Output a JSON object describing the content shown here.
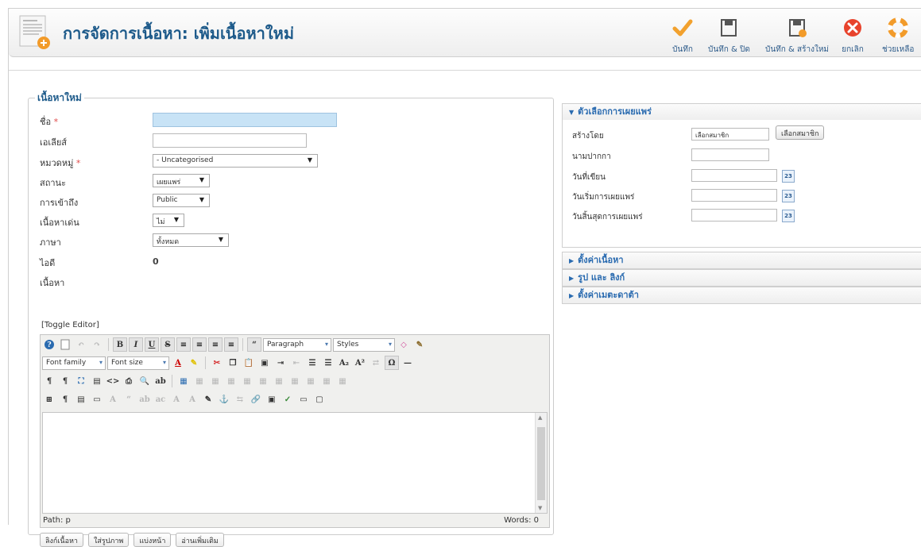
{
  "header": {
    "title": "การจัดการเนื้อหา: เพิ่มเนื้อหาใหม่"
  },
  "toolbar": {
    "save": "บันทึก",
    "save_close": "บันทึก & ปิด",
    "save_new": "บันทึก & สร้างใหม่",
    "cancel": "ยกเลิก",
    "help": "ช่วยเหลือ"
  },
  "form": {
    "legend": "เนื้อหาใหม่",
    "title_label": "ชื่อ",
    "alias_label": "เอเลียส์",
    "category_label": "หมวดหมู่",
    "category_value": "- Uncategorised",
    "status_label": "สถานะ",
    "status_value": "เผยแพร่",
    "access_label": "การเข้าถึง",
    "access_value": "Public",
    "featured_label": "เนื้อหาเด่น",
    "featured_value": "ไม่",
    "language_label": "ภาษา",
    "language_value": "ทั้งหมด",
    "id_label": "ไอดี",
    "id_value": "0",
    "content_label": "เนื้อหา",
    "required_mark": "*"
  },
  "editor": {
    "toggle": "[Toggle Editor]",
    "format_value": "Paragraph",
    "styles_value": "Styles",
    "font_family": "Font family",
    "font_size": "Font size",
    "path": "Path: p",
    "words": "Words: 0"
  },
  "bottom_buttons": [
    "ลิงก์เนื้อหา",
    "ใส่รูปภาพ",
    "แบ่งหน้า",
    "อ่านเพิ่มเติม"
  ],
  "publishing": {
    "header": "ตัวเลือกการเผยแพร่",
    "created_by_label": "สร้างโดย",
    "created_by_value": "เลือกสมาชิก",
    "select_user_button": "เลือกสมาชิก",
    "alias_label": "นามปากกา",
    "created_date_label": "วันที่เขียน",
    "publish_up_label": "วันเริ่มการเผยแพร่",
    "publish_down_label": "วันสิ้นสุดการเผยแพร่",
    "calendar_text": "23"
  },
  "panels": {
    "content_settings": "ตั้งค่าเนื้อหา",
    "images_links": "รูป และ ลิงก์",
    "metadata": "ตั้งค่าเมตะดาต้า"
  },
  "colors": {
    "title_blue": "#1d5a8a",
    "accordion_blue": "#2a6bb0",
    "save_check": "#f2a12e",
    "cancel_red": "#e8432c",
    "help_orange": "#f29b2a",
    "required_red": "#e04b4b"
  }
}
